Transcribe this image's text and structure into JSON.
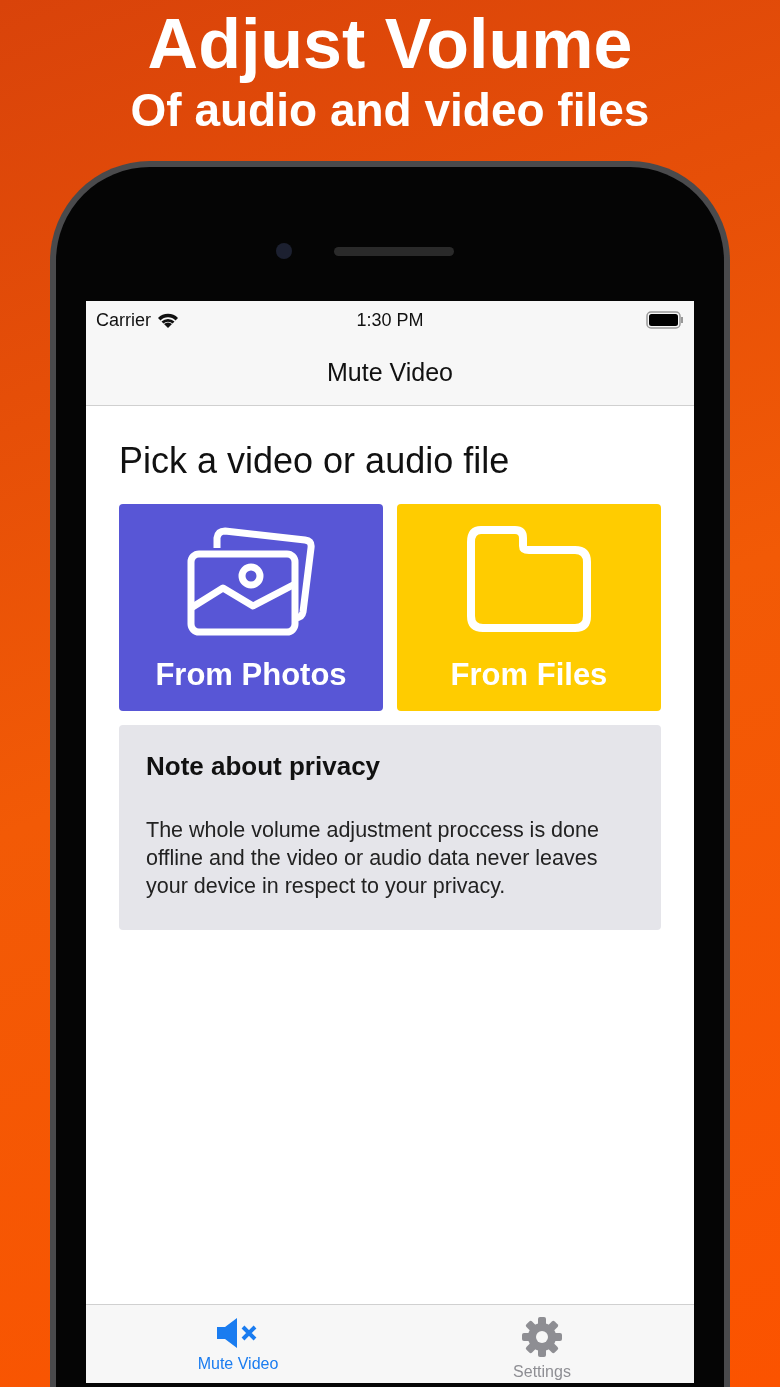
{
  "headline": "Adjust Volume",
  "subheadline": "Of audio and video files",
  "status_bar": {
    "carrier": "Carrier",
    "time": "1:30 PM"
  },
  "nav_title": "Mute Video",
  "heading": "Pick a video or audio file",
  "sources": [
    {
      "label": "From Photos",
      "kind": "photos",
      "color": "#5856d6"
    },
    {
      "label": "From Files",
      "kind": "files",
      "color": "#ffcc00"
    }
  ],
  "note": {
    "title": "Note about privacy",
    "body": "The whole volume adjustment proccess is done offline and the video or audio data never leaves your device in respect to your privacy."
  },
  "tab_bar": [
    {
      "label": "Mute Video",
      "kind": "mute",
      "selected": true
    },
    {
      "label": "Settings",
      "kind": "settings",
      "selected": false
    }
  ]
}
